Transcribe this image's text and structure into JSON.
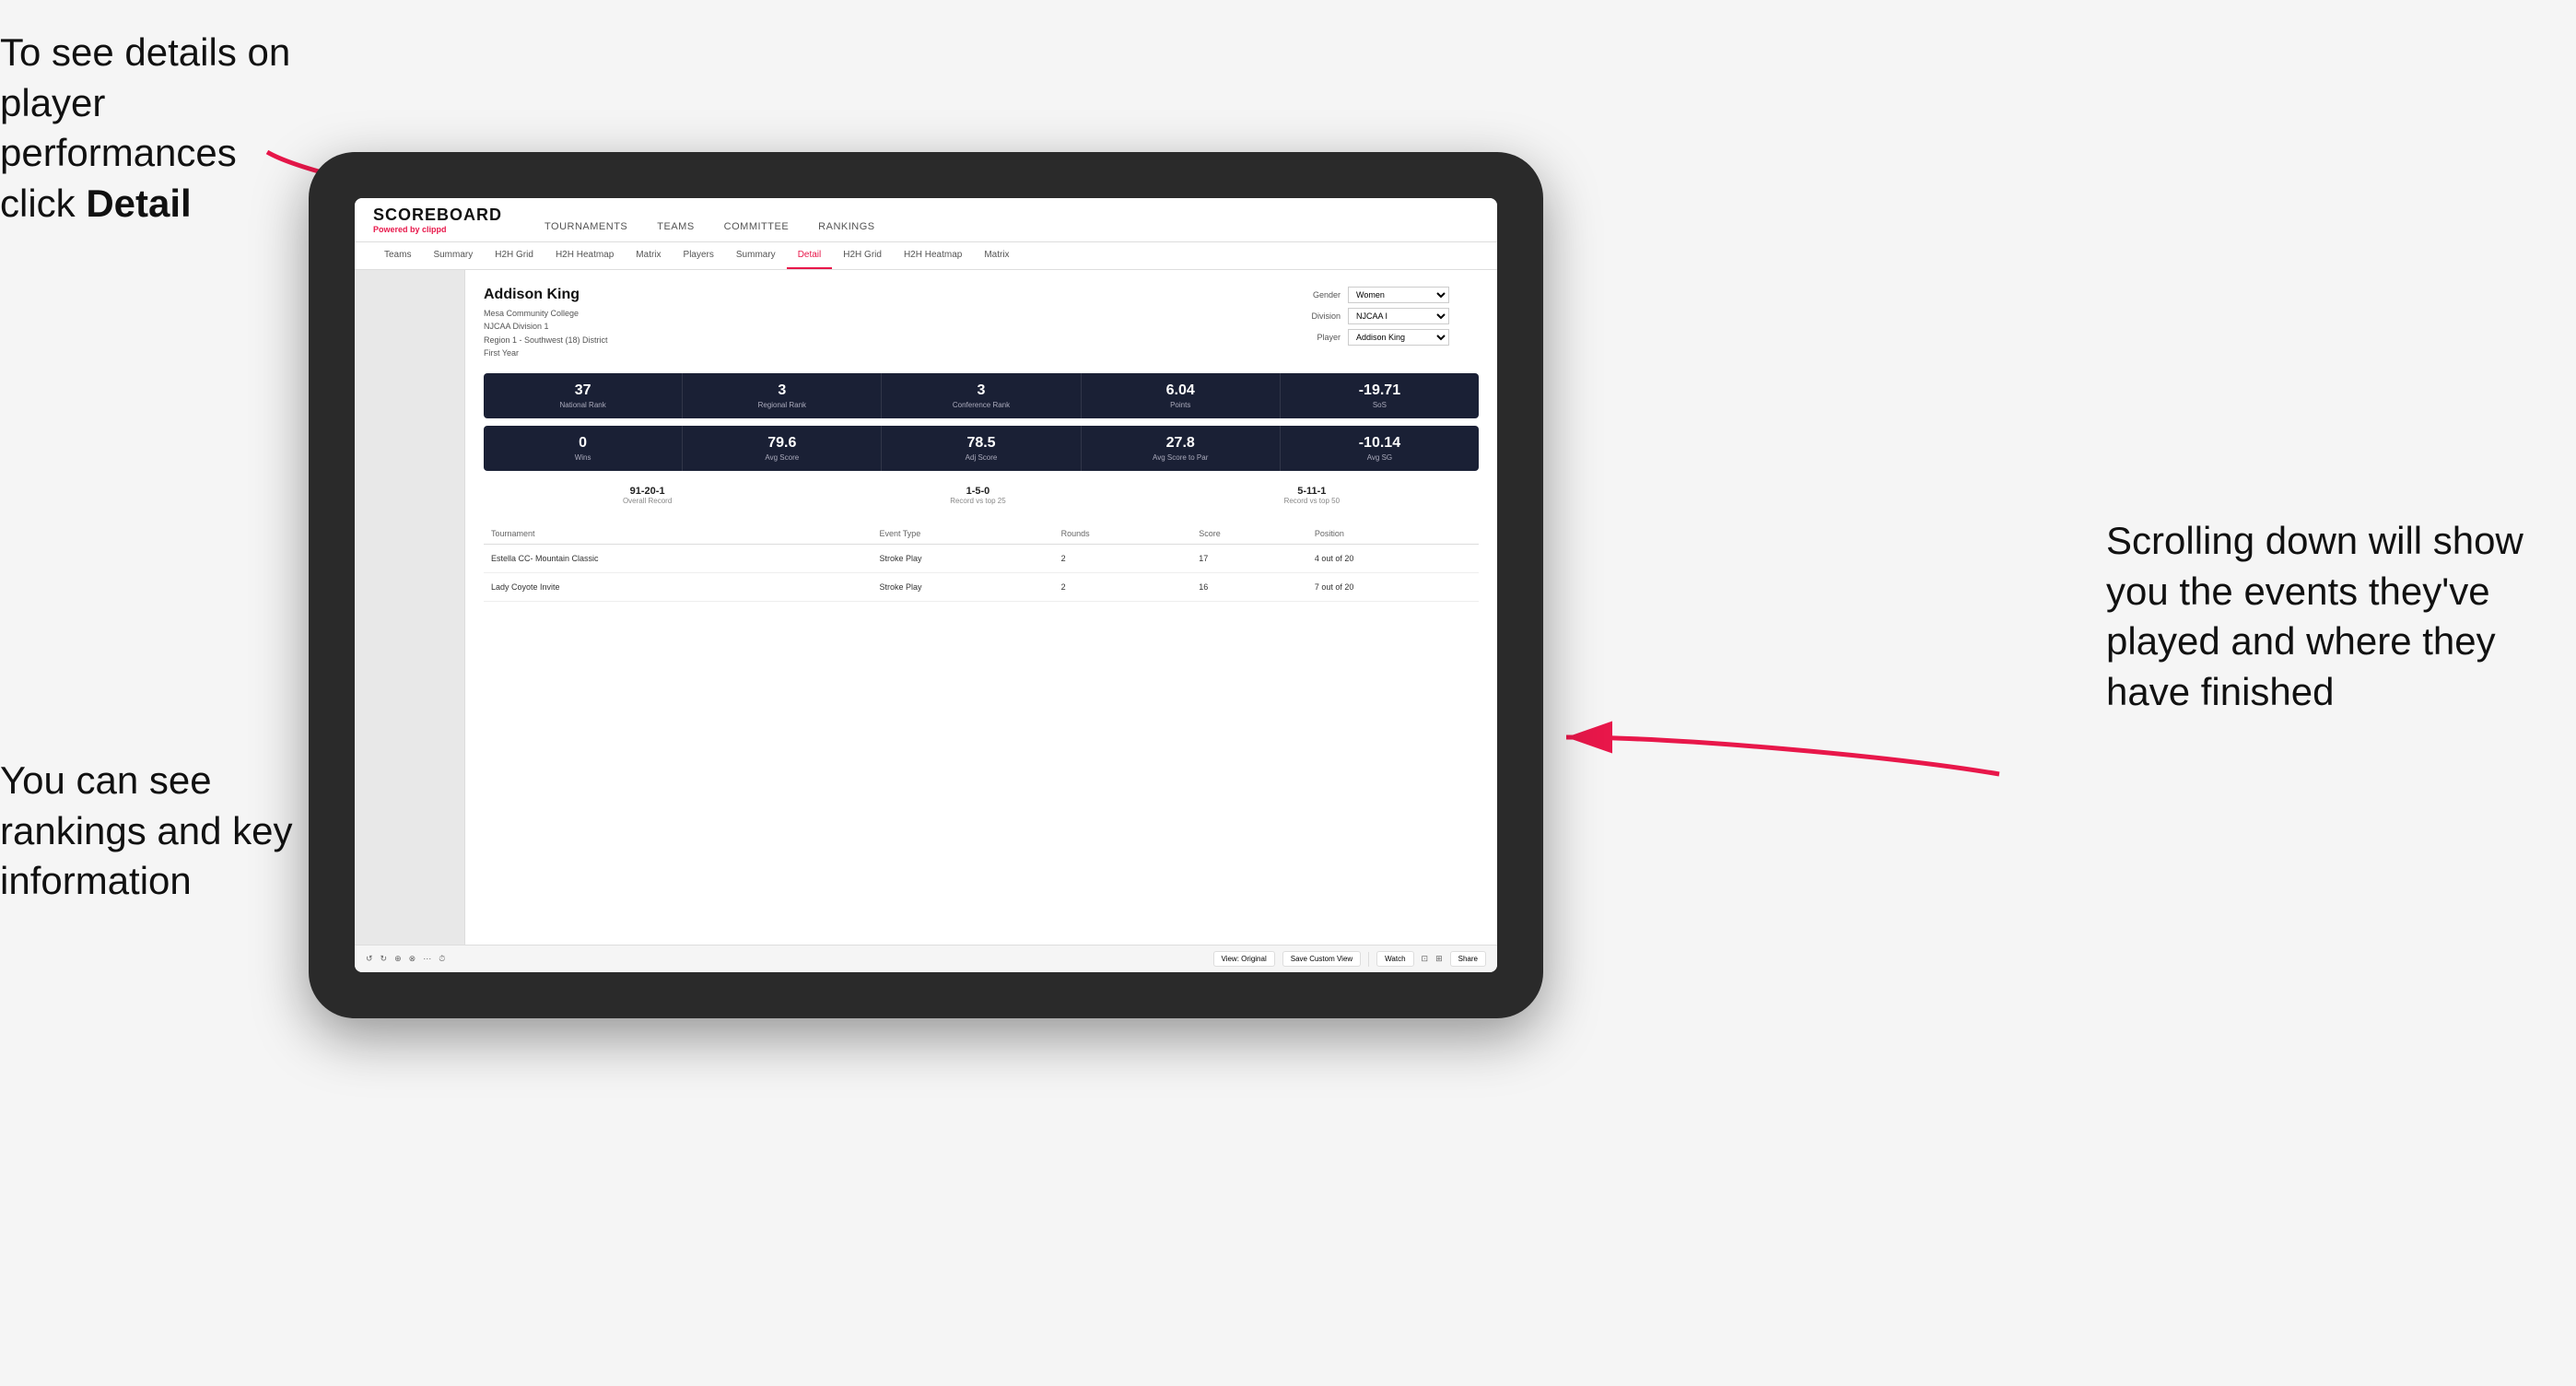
{
  "annotations": {
    "left_text": "To see details on player performances click ",
    "left_bold": "Detail",
    "right_text": "Scrolling down will show you the events they've played and where they have finished",
    "bottom_left_text": "You can see rankings and key information"
  },
  "nav": {
    "logo": "SCOREBOARD",
    "logo_sub": "Powered by ",
    "logo_brand": "clippd",
    "main_items": [
      "TOURNAMENTS",
      "TEAMS",
      "COMMITTEE",
      "RANKINGS"
    ],
    "sub_items": [
      "Teams",
      "Summary",
      "H2H Grid",
      "H2H Heatmap",
      "Matrix",
      "Players",
      "Summary",
      "Detail",
      "H2H Grid",
      "H2H Heatmap",
      "Matrix"
    ],
    "active_sub": "Detail"
  },
  "player": {
    "name": "Addison King",
    "school": "Mesa Community College",
    "division": "NJCAA Division 1",
    "region": "Region 1 - Southwest (18) District",
    "year": "First Year"
  },
  "filters": {
    "gender_label": "Gender",
    "gender_value": "Women",
    "division_label": "Division",
    "division_value": "NJCAA I",
    "player_label": "Player",
    "player_value": "Addison King"
  },
  "stats_row1": [
    {
      "value": "37",
      "label": "National Rank"
    },
    {
      "value": "3",
      "label": "Regional Rank"
    },
    {
      "value": "3",
      "label": "Conference Rank"
    },
    {
      "value": "6.04",
      "label": "Points"
    },
    {
      "value": "-19.71",
      "label": "SoS"
    }
  ],
  "stats_row2": [
    {
      "value": "0",
      "label": "Wins"
    },
    {
      "value": "79.6",
      "label": "Avg Score"
    },
    {
      "value": "78.5",
      "label": "Adj Score"
    },
    {
      "value": "27.8",
      "label": "Avg Score to Par"
    },
    {
      "value": "-10.14",
      "label": "Avg SG"
    }
  ],
  "records": [
    {
      "value": "91-20-1",
      "label": "Overall Record"
    },
    {
      "value": "1-5-0",
      "label": "Record vs top 25"
    },
    {
      "value": "5-11-1",
      "label": "Record vs top 50"
    }
  ],
  "table": {
    "headers": [
      "Tournament",
      "Event Type",
      "Rounds",
      "Score",
      "Position"
    ],
    "rows": [
      {
        "tournament": "Estella CC- Mountain Classic",
        "event_type": "Stroke Play",
        "rounds": "2",
        "score": "17",
        "position": "4 out of 20"
      },
      {
        "tournament": "Lady Coyote Invite",
        "event_type": "Stroke Play",
        "rounds": "2",
        "score": "16",
        "position": "7 out of 20"
      }
    ]
  },
  "toolbar": {
    "view_original": "View: Original",
    "save_custom": "Save Custom View",
    "watch": "Watch",
    "share": "Share"
  }
}
